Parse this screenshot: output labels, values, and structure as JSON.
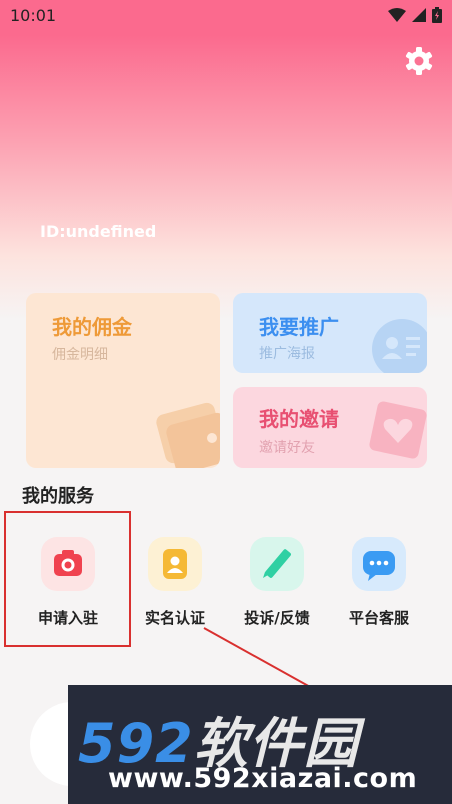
{
  "status_bar": {
    "time": "10:01"
  },
  "profile": {
    "id_text": "ID:undefined"
  },
  "cards": {
    "commission": {
      "title": "我的佣金",
      "subtitle": "佣金明细"
    },
    "promote": {
      "title": "我要推广",
      "subtitle": "推广海报"
    },
    "invite": {
      "title": "我的邀请",
      "subtitle": "邀请好友"
    }
  },
  "services": {
    "title": "我的服务",
    "items": [
      {
        "label": "申请入驻",
        "icon": "camera-icon",
        "color": "#f0424f"
      },
      {
        "label": "实名认证",
        "icon": "person-badge-icon",
        "color": "#f5b935"
      },
      {
        "label": "投诉/反馈",
        "icon": "pencil-icon",
        "color": "#2fd0a3"
      },
      {
        "label": "平台客服",
        "icon": "chat-bubble-icon",
        "color": "#3a9bf3"
      }
    ]
  },
  "watermark": {
    "brand_number": "592",
    "brand_text": "软件园",
    "url": "www.592xiazai.com"
  },
  "colors": {
    "header_pink": "#fb6a8e",
    "highlight_red": "#d9302f"
  }
}
